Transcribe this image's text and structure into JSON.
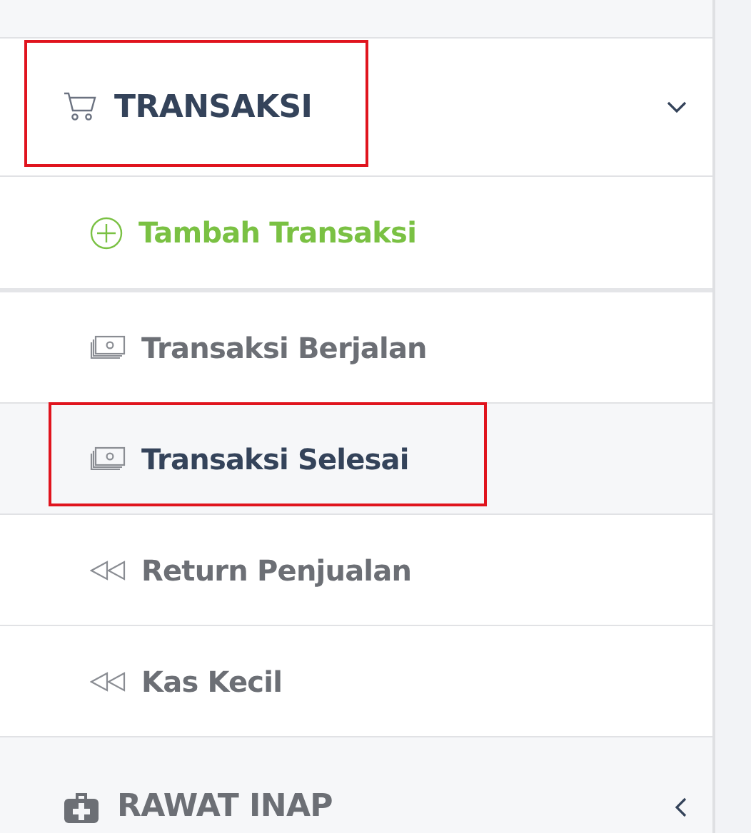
{
  "sections": [
    {
      "title": "TRANSAKSI",
      "expanded": true,
      "highlighted": true,
      "items": [
        {
          "label": "Tambah Transaksi",
          "kind": "add",
          "selected": false,
          "highlighted": false
        },
        {
          "label": "Transaksi Berjalan",
          "kind": "link",
          "selected": false,
          "highlighted": false
        },
        {
          "label": "Transaksi Selesai",
          "kind": "link",
          "selected": true,
          "highlighted": true
        },
        {
          "label": "Return Penjualan",
          "kind": "link",
          "selected": false,
          "highlighted": false
        },
        {
          "label": "Kas Kecil",
          "kind": "link",
          "selected": false,
          "highlighted": false
        }
      ]
    },
    {
      "title": "RAWAT INAP",
      "expanded": false,
      "highlighted": false
    }
  ]
}
